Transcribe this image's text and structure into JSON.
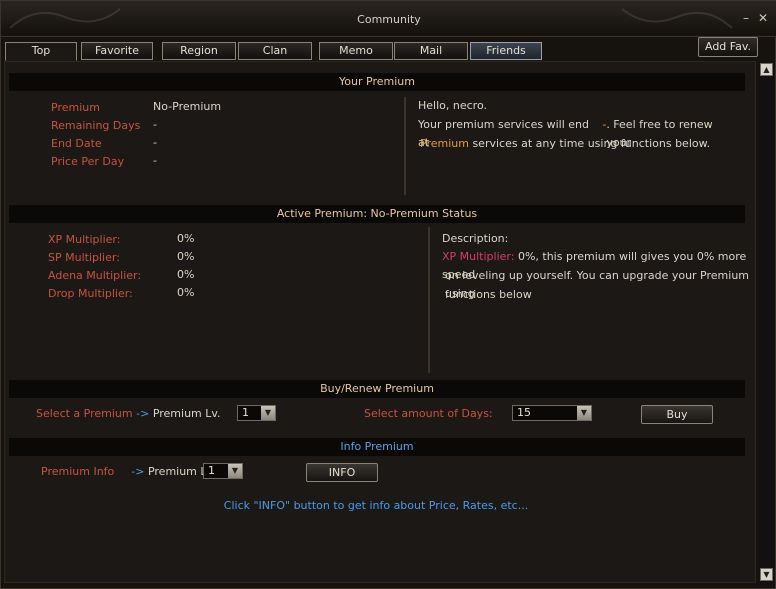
{
  "window": {
    "title": "Community"
  },
  "tabs": [
    "Top",
    "Favorite",
    "Region",
    "Clan",
    "Memo",
    "Mail",
    "Friends"
  ],
  "add_fav": "Add Fav.",
  "your_premium": {
    "header": "Your Premium",
    "fields": [
      {
        "label": "Premium",
        "value": "No-Premium"
      },
      {
        "label": "Remaining Days",
        "value": "-"
      },
      {
        "label": "End Date",
        "value": "-"
      },
      {
        "label": "Price Per Day",
        "value": "-"
      }
    ],
    "greeting": "Hello, necro.",
    "msg_part1": "Your premium services will end at",
    "msg_dash": "-",
    "msg_part2": ". Feel free to renew your",
    "msg_premium": "Premium",
    "msg_part3": "services at any time using functions below."
  },
  "active_premium": {
    "header": "Active Premium: No-Premium Status",
    "fields": [
      {
        "label": "XP Multiplier:",
        "value": "0%"
      },
      {
        "label": "SP Multiplier:",
        "value": "0%"
      },
      {
        "label": "Adena Multiplier:",
        "value": "0%"
      },
      {
        "label": "Drop Multiplier:",
        "value": "0%"
      }
    ],
    "desc_title": "Description:",
    "desc_label": "XP Multiplier:",
    "desc_line1": "0%, this premium will gives you 0% more speed",
    "desc_line2": "on leveling up yourself. You can upgrade your Premium using",
    "desc_line3": "functions below"
  },
  "buy_renew": {
    "header": "Buy/Renew Premium",
    "select_premium": "Select a Premium",
    "arrow": "->",
    "premium_lv": "Premium Lv.",
    "premium_lv_value": "1",
    "select_days": "Select amount of Days:",
    "days_value": "15",
    "buy_button": "Buy"
  },
  "info_premium": {
    "header": "Info Premium",
    "premium_info": "Premium Info",
    "arrow": "->",
    "premium_lv": "Premium Lv.",
    "premium_lv_value": "1",
    "info_button": "INFO",
    "hint": "Click \"INFO\" button to get info about Price, Rates, etc..."
  },
  "colors": {
    "label": "#c9533e",
    "accent_blue": "#4a9be8",
    "header_text": "#e6c89a",
    "pink": "#d63d6b"
  }
}
